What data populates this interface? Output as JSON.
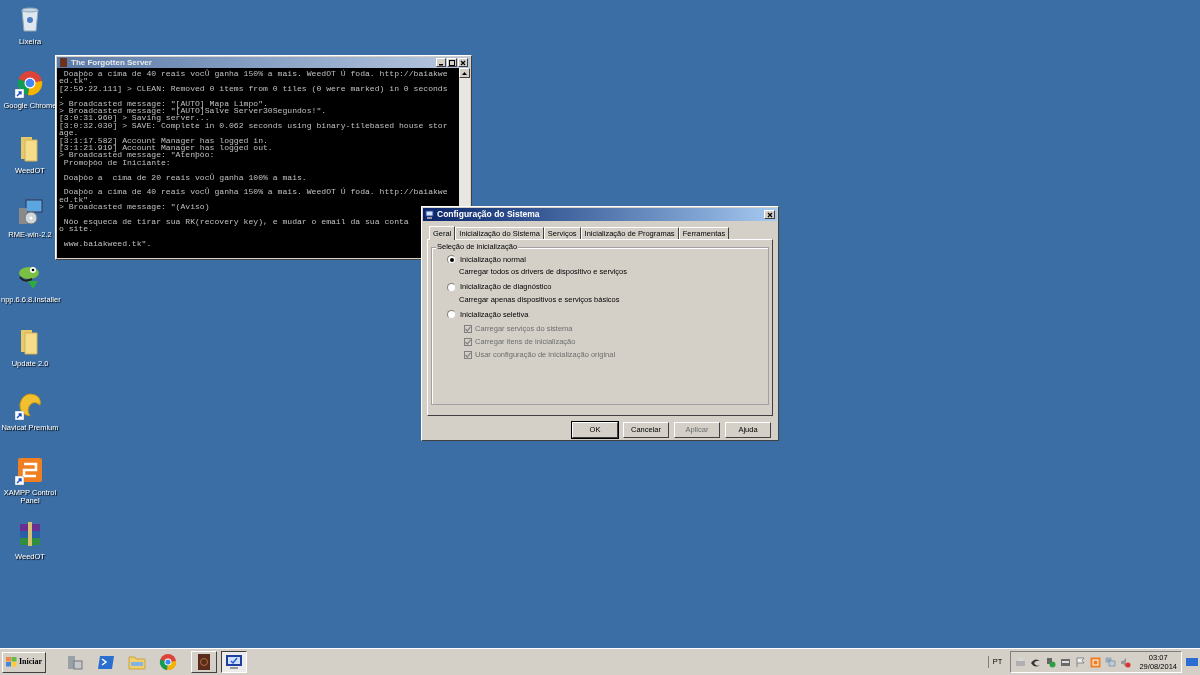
{
  "desktop_icons": [
    {
      "label": "Lixeira",
      "kind": "recycle-bin",
      "shortcut": false
    },
    {
      "label": "Google Chrome",
      "kind": "browser",
      "shortcut": true
    },
    {
      "label": "WeedOT",
      "kind": "folder",
      "shortcut": false
    },
    {
      "label": "RME-win-2.2",
      "kind": "installer",
      "shortcut": false
    },
    {
      "label": "npp.6.6.8.Installer",
      "kind": "lizard",
      "shortcut": false
    },
    {
      "label": "Update 2.0",
      "kind": "folder",
      "shortcut": false
    },
    {
      "label": "Navicat Premium",
      "kind": "swirl",
      "shortcut": true
    },
    {
      "label": "XAMPP Control Panel",
      "kind": "orange-tile",
      "shortcut": true
    },
    {
      "label": "WeedOT",
      "kind": "books",
      "shortcut": false
    }
  ],
  "console_window": {
    "title": "The Forgotten Server",
    "active": false,
    "paragraphs": [
      {
        "lines": [
          " Doaþòo a cima de 40 reais vocÛ ganha 150% a mais. WeedOT Ú foda. http://baiakwe",
          "ed.tk\".",
          "[2:59:22.111] > CLEAN: Removed 0 items from 0 tiles (0 were marked) in 0 seconds",
          ".",
          "> Broadcasted message: \"[AUTO] Mapa Limpo\".",
          "> Broadcasted message: \"[AUTO]Salve Server30Segundos!\".",
          "[3:0:31.960] > Saving server...",
          "[3:0:32.030] > SAVE: Complete in 0.062 seconds using binary-tilebased house stor",
          "age.",
          "[3:1:17.582] Account Manager has logged in.",
          "[3:1:21.919] Account Manager has logged out.",
          "> Broadcasted message: \"Atenþòo:",
          " Promoþòo de Iniciante:"
        ]
      },
      {
        "lines": [
          " Doaþòo a  cima de 20 reais vocÛ ganha 100% a mais."
        ]
      },
      {
        "lines": [
          " Doaþòo a cima de 40 reais vocÛ ganha 150% a mais. WeedOT Ú foda. http://baiakwe",
          "ed.tk\".",
          "> Broadcasted message: \"(Aviso)"
        ]
      },
      {
        "lines": [
          " Nòo esqueca de tirar sua RK(recovery key), e mudar o email da sua conta",
          "o site."
        ]
      },
      {
        "lines": [
          " www.baiakweed.tk\"."
        ]
      }
    ]
  },
  "dialog": {
    "title": "Configuração do Sistema",
    "active": true,
    "tabs": [
      {
        "label": "Geral",
        "selected": true
      },
      {
        "label": "Inicialização do Sistema",
        "selected": false
      },
      {
        "label": "Serviços",
        "selected": false
      },
      {
        "label": "Inicialização de Programas",
        "selected": false
      },
      {
        "label": "Ferramentas",
        "selected": false
      }
    ],
    "group_label": "Seleção de inicialização",
    "radios": [
      {
        "label": "Inicialização normal",
        "description": "Carregar todos os drivers de dispositivo e serviços",
        "selected": true
      },
      {
        "label": "Inicialização de diagnóstico",
        "description": "Carregar apenas dispositivos e serviços básicos",
        "selected": false
      },
      {
        "label": "Inicialização seletiva",
        "selected": false
      }
    ],
    "checkboxes": [
      {
        "label": "Carregar serviços do sistema",
        "checked": true,
        "disabled": true
      },
      {
        "label": "Carregar itens de inicialização",
        "checked": true,
        "disabled": true
      },
      {
        "label": "Usar configuração de inicialização original",
        "checked": true,
        "disabled": true
      }
    ],
    "buttons": [
      {
        "label": "OK",
        "default": true,
        "disabled": false
      },
      {
        "label": "Cancelar",
        "default": false,
        "disabled": false
      },
      {
        "label": "Aplicar",
        "default": false,
        "disabled": true
      },
      {
        "label": "Ajuda",
        "default": false,
        "disabled": false
      }
    ]
  },
  "taskbar": {
    "start_label": "Iniciar",
    "quick_launch": [
      {
        "kind": "server"
      },
      {
        "kind": "terminal"
      },
      {
        "kind": "folder"
      },
      {
        "kind": "browser"
      }
    ],
    "tasks": [
      {
        "kind": "book",
        "selected": false
      },
      {
        "kind": "monitor",
        "selected": true
      }
    ],
    "language": "PT",
    "time": "03:07",
    "date": "29/08/2014"
  }
}
